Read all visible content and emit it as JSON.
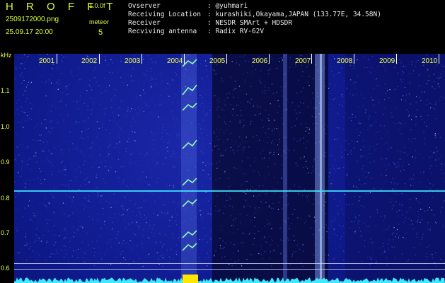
{
  "header": {
    "app_title": "H R O F F T",
    "version": "1.0.0f",
    "filename": "2509172000.png",
    "meteor_label": "meteor",
    "date": "25.09.17 20:00",
    "meteor_count": "5"
  },
  "meta": [
    {
      "key": "Ovserver",
      "value": ": @yuhmari"
    },
    {
      "key": "Receiving Location",
      "value": ": kurashiki,Okayama,JAPAN (133.77E, 34.58N)"
    },
    {
      "key": "Receiver",
      "value": ": NESDR SMArt + HDSDR"
    },
    {
      "key": "Recviving antenna",
      "value": ": Radix RV-62V"
    }
  ],
  "axis": {
    "unit": "kHz",
    "ticks": [
      "1.1",
      "1.0",
      "0.9",
      "0.8",
      "0.7",
      "0.6"
    ]
  },
  "years": [
    "2001",
    "2002",
    "2003",
    "2004",
    "2005",
    "2006",
    "2007",
    "2008",
    "2009",
    "2010"
  ],
  "colors": {
    "label": "#d8ff3c",
    "background": "#0f1a8c",
    "signal": "#3ee8ff",
    "meteor": "#8cffb4"
  }
}
